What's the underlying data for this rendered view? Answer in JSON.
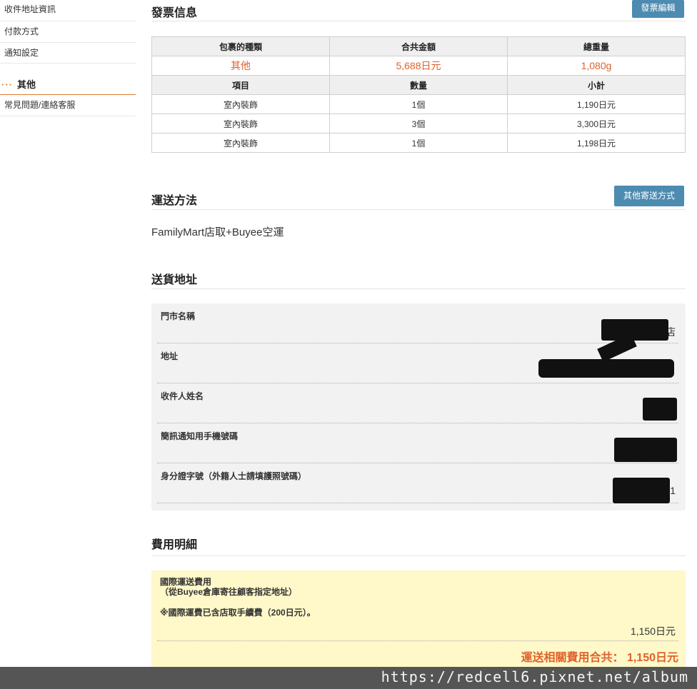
{
  "sidebar": {
    "items": [
      "收件地址資訊",
      "付款方式",
      "通知設定"
    ],
    "heading_dots": "···",
    "heading": "其他",
    "other_items": [
      "常見問題/連絡客服"
    ]
  },
  "invoice": {
    "title": "發票信息",
    "edit_button": "發票編輯",
    "header1": [
      "包裹的種類",
      "合共金額",
      "總重量"
    ],
    "summary": [
      "其他",
      "5,688日元",
      "1,080g"
    ],
    "header2": [
      "項目",
      "數量",
      "小計"
    ],
    "rows": [
      [
        "室內裝飾",
        "1個",
        "1,190日元"
      ],
      [
        "室內裝飾",
        "3個",
        "3,300日元"
      ],
      [
        "室內裝飾",
        "1個",
        "1,198日元"
      ]
    ]
  },
  "shipping": {
    "title": "運送方法",
    "other_button": "其他寄送方式",
    "method": "FamilyMart店取+Buyee空運"
  },
  "address": {
    "title": "送貨地址",
    "fields": [
      {
        "label": "門市名稱",
        "value_visible": "店"
      },
      {
        "label": "地址",
        "value_visible": ""
      },
      {
        "label": "收件人姓名",
        "value_visible": ""
      },
      {
        "label": "簡訊通知用手機號碼",
        "value_visible": ""
      },
      {
        "label": "身分證字號（外籍人士請填護照號碼）",
        "value_visible": "1"
      }
    ]
  },
  "fees": {
    "title": "費用明細",
    "line1": "國際運送費用",
    "line2": "（從Buyee倉庫寄往顧客指定地址）",
    "note": "※國際運費已含店取手續費（200日元）。",
    "amount": "1,150日元",
    "total": "運送相關費用合共： 1,150日元"
  },
  "watermark": "https://redcell6.pixnet.net/album",
  "colors": {
    "accent": "#e0622b",
    "button": "#4d8bb1",
    "fee_bg": "#fff8c9",
    "sidebar_accent": "#e07b2f"
  }
}
